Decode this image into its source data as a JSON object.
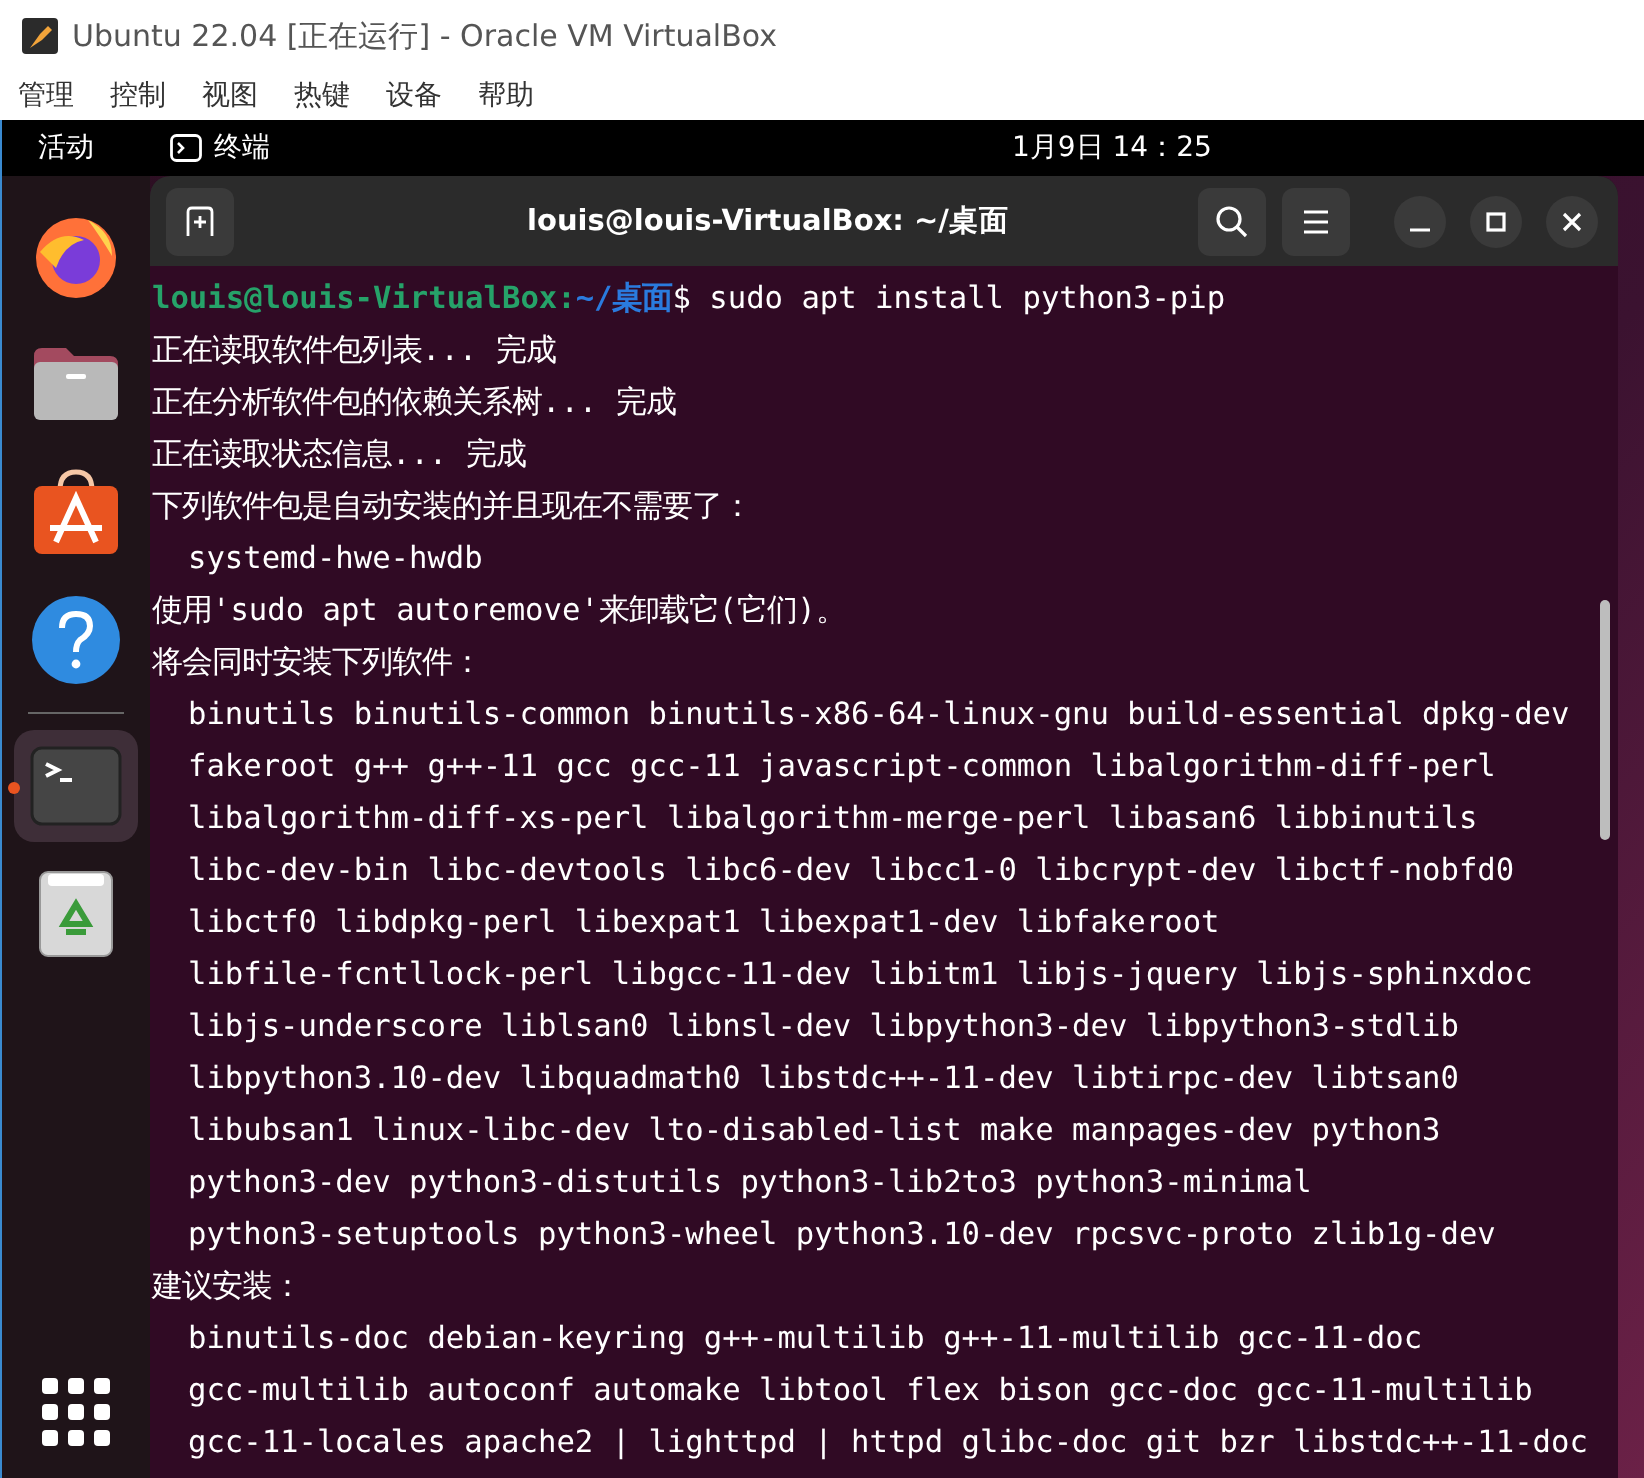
{
  "host_window": {
    "title": "Ubuntu 22.04 [正在运行] - Oracle VM VirtualBox",
    "menu": [
      "管理",
      "控制",
      "视图",
      "热键",
      "设备",
      "帮助"
    ]
  },
  "top_bar": {
    "activities": "活动",
    "app": "终端",
    "clock": "1月9日  14：25"
  },
  "dock": [
    {
      "kind": "browser",
      "running": false
    },
    {
      "kind": "files",
      "running": false
    },
    {
      "kind": "software",
      "running": false
    },
    {
      "kind": "help",
      "running": false
    },
    {
      "kind": "terminal",
      "running": true
    },
    {
      "kind": "trash",
      "running": false
    }
  ],
  "terminal": {
    "title": "louis@louis-VirtualBox: ~/桌面",
    "prompt": {
      "user_host": "louis@louis-VirtualBox",
      "separator": ":",
      "path": "~/桌面",
      "command": "$ sudo apt install python3-pip"
    },
    "lines": [
      {
        "kind": "message",
        "text": "正在读取软件包列表... 完成"
      },
      {
        "kind": "message",
        "text": "正在分析软件包的依赖关系树... 完成"
      },
      {
        "kind": "message",
        "text": "正在读取状态信息... 完成"
      },
      {
        "kind": "message",
        "text": "下列软件包是自动安装的并且现在不需要了："
      },
      {
        "kind": "package",
        "text": "systemd-hwe-hwdb"
      },
      {
        "kind": "message",
        "text": "使用'sudo apt autoremove'来卸载它(它们)。"
      },
      {
        "kind": "message",
        "text": "将会同时安装下列软件："
      },
      {
        "kind": "package",
        "text": "binutils binutils-common binutils-x86-64-linux-gnu build-essential dpkg-dev"
      },
      {
        "kind": "package",
        "text": "fakeroot g++ g++-11 gcc gcc-11 javascript-common libalgorithm-diff-perl"
      },
      {
        "kind": "package",
        "text": "libalgorithm-diff-xs-perl libalgorithm-merge-perl libasan6 libbinutils"
      },
      {
        "kind": "package",
        "text": "libc-dev-bin libc-devtools libc6-dev libcc1-0 libcrypt-dev libctf-nobfd0"
      },
      {
        "kind": "package",
        "text": "libctf0 libdpkg-perl libexpat1 libexpat1-dev libfakeroot"
      },
      {
        "kind": "package",
        "text": "libfile-fcntllock-perl libgcc-11-dev libitm1 libjs-jquery libjs-sphinxdoc"
      },
      {
        "kind": "package",
        "text": "libjs-underscore liblsan0 libnsl-dev libpython3-dev libpython3-stdlib"
      },
      {
        "kind": "package",
        "text": "libpython3.10-dev libquadmath0 libstdc++-11-dev libtirpc-dev libtsan0"
      },
      {
        "kind": "package",
        "text": "libubsan1 linux-libc-dev lto-disabled-list make manpages-dev python3"
      },
      {
        "kind": "package",
        "text": "python3-dev python3-distutils python3-lib2to3 python3-minimal"
      },
      {
        "kind": "package",
        "text": "python3-setuptools python3-wheel python3.10-dev rpcsvc-proto zlib1g-dev"
      },
      {
        "kind": "message",
        "text": "建议安装："
      },
      {
        "kind": "package",
        "text": "binutils-doc debian-keyring g++-multilib g++-11-multilib gcc-11-doc"
      },
      {
        "kind": "package",
        "text": "gcc-multilib autoconf automake libtool flex bison gcc-doc gcc-11-multilib"
      },
      {
        "kind": "package",
        "text": "gcc-11-locales apache2 | lighttpd | httpd glibc-doc git bzr libstdc++-11-doc"
      }
    ]
  }
}
